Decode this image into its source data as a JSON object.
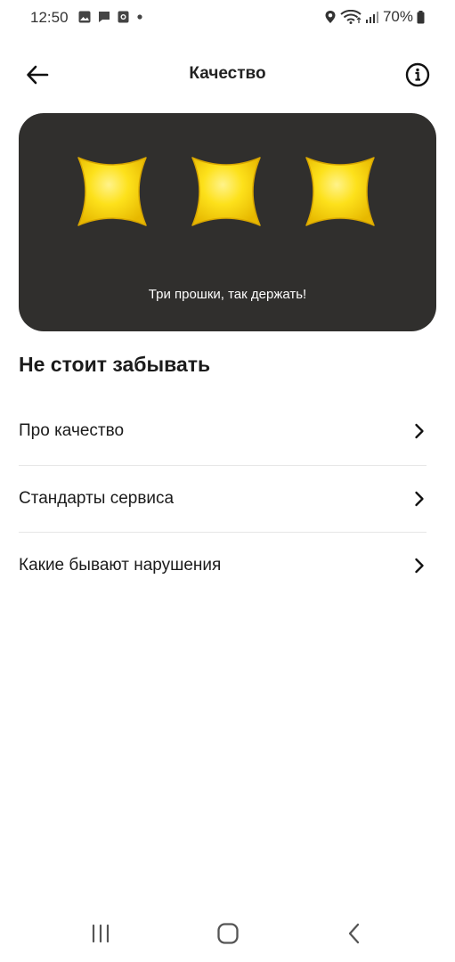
{
  "status_bar": {
    "time": "12:50",
    "battery": "70%",
    "icons": [
      "image-icon",
      "message-icon",
      "camera-icon",
      "dot-icon",
      "location-icon",
      "wifi-icon",
      "signal-icon",
      "battery-icon"
    ]
  },
  "header": {
    "title": "Качество",
    "back_icon": "arrow-left-icon",
    "info_icon": "info-icon"
  },
  "rating_card": {
    "stars_count": 3,
    "star_color": "#f5d400",
    "background": "#302f2d",
    "caption": "Три прошки, так держать!"
  },
  "section": {
    "title": "Не стоит забывать",
    "items": [
      {
        "label": "Про качество"
      },
      {
        "label": "Стандарты сервиса"
      },
      {
        "label": "Какие бывают нарушения"
      }
    ]
  },
  "nav_bar": {
    "icons": [
      "recent-apps-icon",
      "home-icon",
      "back-nav-icon"
    ]
  }
}
